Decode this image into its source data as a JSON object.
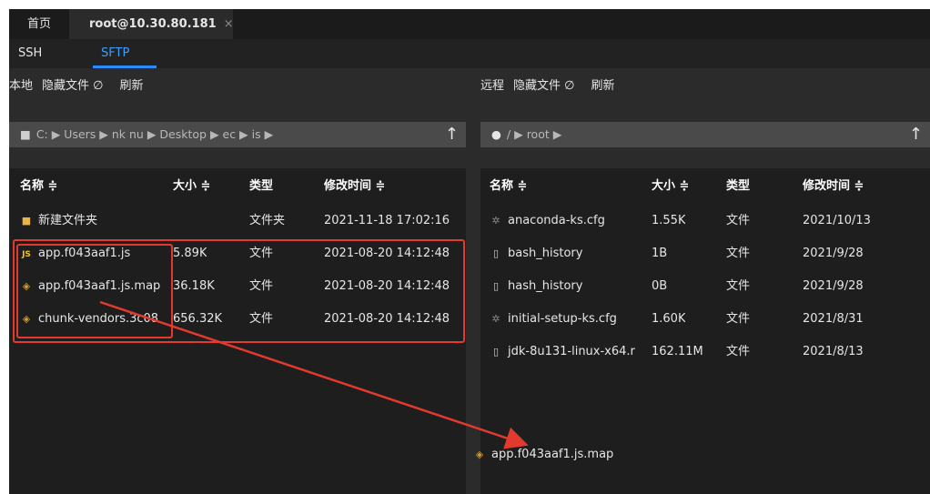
{
  "tabs": {
    "home": "首页",
    "session": "root@10.30.80.181",
    "close": "×"
  },
  "subtabs": {
    "ssh": "SSH",
    "sftp": "SFTP"
  },
  "local": {
    "toolbar": {
      "label": "本地",
      "hidden": "隐藏文件 ∅",
      "refresh": "刷新"
    },
    "path": "C: ▶ Users ▶ nk nu ▶ Desktop ▶ ec ▶ is ▶",
    "up": "↑",
    "headers": {
      "name": "名称 ≑",
      "size": "大小 ≑",
      "type": "类型",
      "mtime": "修改时间 ≑"
    },
    "files": [
      {
        "name": "新建文件夹",
        "size": "",
        "type": "文件夹",
        "mtime": "2021-11-18 17:02:16",
        "icon": "folder-icon"
      },
      {
        "name": "app.f043aaf1.js",
        "size": "5.89K",
        "type": "文件",
        "mtime": "2021-08-20 14:12:48",
        "icon": "js-file-icon"
      },
      {
        "name": "app.f043aaf1.js.map",
        "size": "36.18K",
        "type": "文件",
        "mtime": "2021-08-20 14:12:48",
        "icon": "map-file-icon"
      },
      {
        "name": "chunk-vendors.3c08",
        "size": "656.32K",
        "type": "文件",
        "mtime": "2021-08-20 14:12:48",
        "icon": "map-file-icon"
      }
    ]
  },
  "remote": {
    "toolbar": {
      "label": "远程",
      "hidden": "隐藏文件 ∅",
      "refresh": "刷新"
    },
    "path": "/ ▶ root ▶",
    "up": "↑",
    "headers": {
      "name": "名称 ≑",
      "size": "大小 ≑",
      "type": "类型",
      "mtime": "修改时间 ≑"
    },
    "files": [
      {
        "name": "anaconda-ks.cfg",
        "size": "1.55K",
        "type": "文件",
        "mtime": "2021/10/13",
        "icon": "gear-icon"
      },
      {
        "name": "bash_history",
        "size": "1B",
        "type": "文件",
        "mtime": "2021/9/28",
        "icon": "document-icon"
      },
      {
        "name": "hash_history",
        "size": "0B",
        "type": "文件",
        "mtime": "2021/9/28",
        "icon": "document-icon"
      },
      {
        "name": "initial-setup-ks.cfg",
        "size": "1.60K",
        "type": "文件",
        "mtime": "2021/8/31",
        "icon": "gear-icon"
      },
      {
        "name": "jdk-8u131-linux-x64.r",
        "size": "162.11M",
        "type": "文件",
        "mtime": "2021/8/13",
        "icon": "document-icon"
      }
    ]
  },
  "drag": {
    "name": "app.f043aaf1.js.map"
  },
  "colors": {
    "accent": "#2b8cff",
    "annotation": "#e23a2e",
    "background": "#2b2b2b"
  }
}
